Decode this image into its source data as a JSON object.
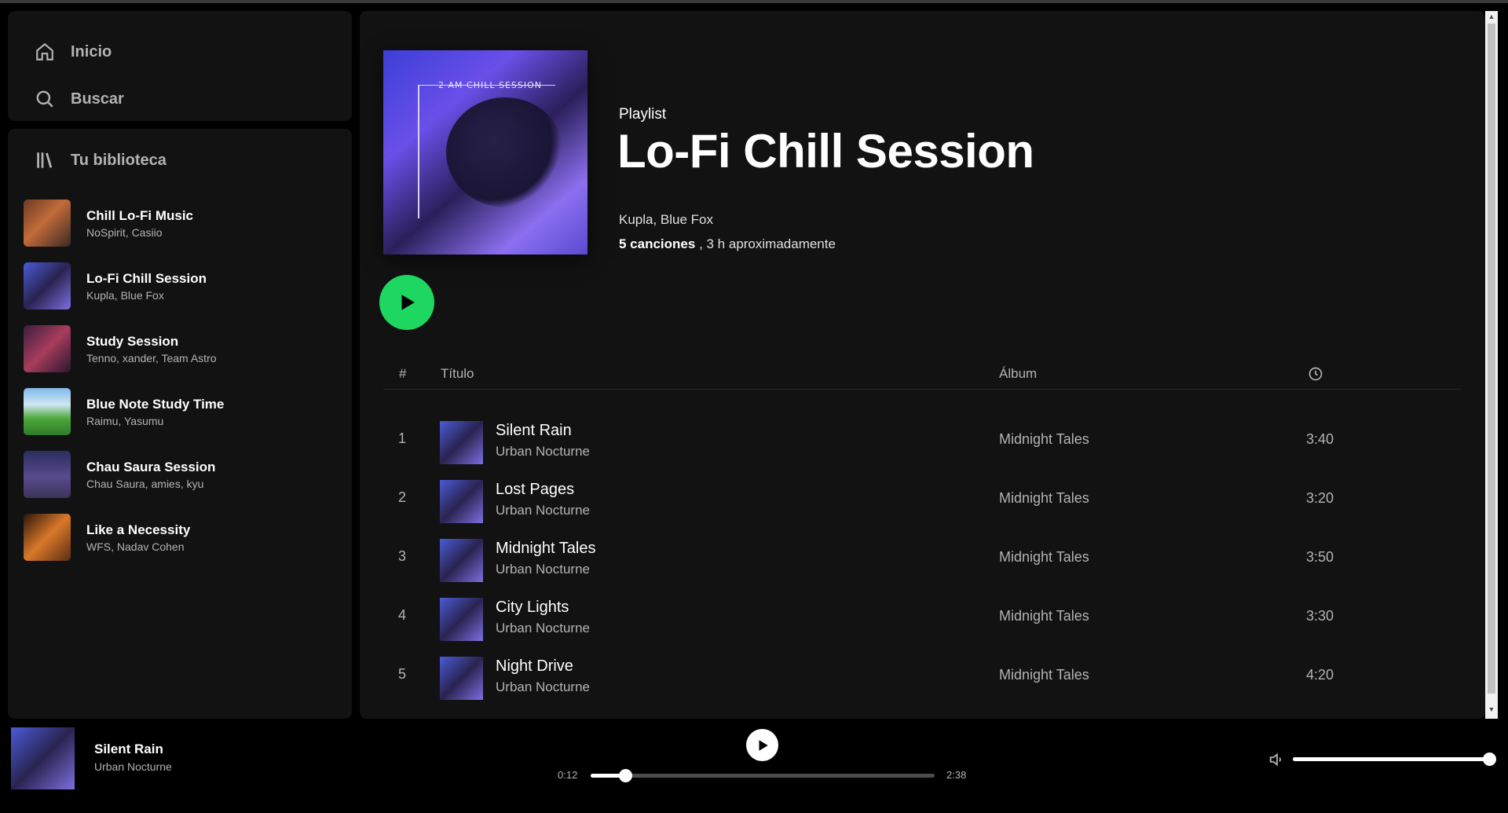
{
  "nav": {
    "home_label": "Inicio",
    "search_label": "Buscar"
  },
  "library": {
    "header": "Tu biblioteca",
    "items": [
      {
        "title": "Chill Lo-Fi Music",
        "subtitle": "NoSpirit, Casiio",
        "thumb_icon": "album-art"
      },
      {
        "title": "Lo-Fi Chill Session",
        "subtitle": "Kupla, Blue Fox",
        "thumb_icon": "album-art"
      },
      {
        "title": "Study Session",
        "subtitle": "Tenno, xander, Team Astro",
        "thumb_icon": "album-art"
      },
      {
        "title": "Blue Note Study Time",
        "subtitle": "Raimu, Yasumu",
        "thumb_icon": "album-art"
      },
      {
        "title": "Chau Saura Session",
        "subtitle": "Chau Saura, amies, kyu",
        "thumb_icon": "album-art"
      },
      {
        "title": "Like a Necessity",
        "subtitle": "WFS, Nadav Cohen",
        "thumb_icon": "album-art"
      }
    ]
  },
  "playlist": {
    "cover_text": "2 AM CHILL SESSION",
    "type_label": "Playlist",
    "title": "Lo-Fi Chill Session",
    "owner": "Kupla, Blue Fox",
    "song_count": "5 canciones",
    "duration": ", 3 h aproximadamente"
  },
  "table": {
    "col_number": "#",
    "col_title": "Título",
    "col_album": "Álbum",
    "col_duration_icon": "clock-icon",
    "rows": [
      {
        "number": "1",
        "title": "Silent Rain",
        "artist": "Urban Nocturne",
        "album": "Midnight Tales",
        "duration": "3:40"
      },
      {
        "number": "2",
        "title": "Lost Pages",
        "artist": "Urban Nocturne",
        "album": "Midnight Tales",
        "duration": "3:20"
      },
      {
        "number": "3",
        "title": "Midnight Tales",
        "artist": "Urban Nocturne",
        "album": "Midnight Tales",
        "duration": "3:50"
      },
      {
        "number": "4",
        "title": "City Lights",
        "artist": "Urban Nocturne",
        "album": "Midnight Tales",
        "duration": "3:30"
      },
      {
        "number": "5",
        "title": "Night Drive",
        "artist": "Urban Nocturne",
        "album": "Midnight Tales",
        "duration": "4:20"
      }
    ]
  },
  "player": {
    "now_playing_title": "Silent Rain",
    "now_playing_artist": "Urban Nocturne",
    "current_time": "0:12",
    "total_time": "2:38",
    "progress_fraction": 0.1,
    "volume_fraction": 1.0
  },
  "colors": {
    "accent": "#1ed760",
    "panel_bg": "#121212",
    "app_bg": "#000000",
    "text_secondary": "#b3b3b3"
  }
}
